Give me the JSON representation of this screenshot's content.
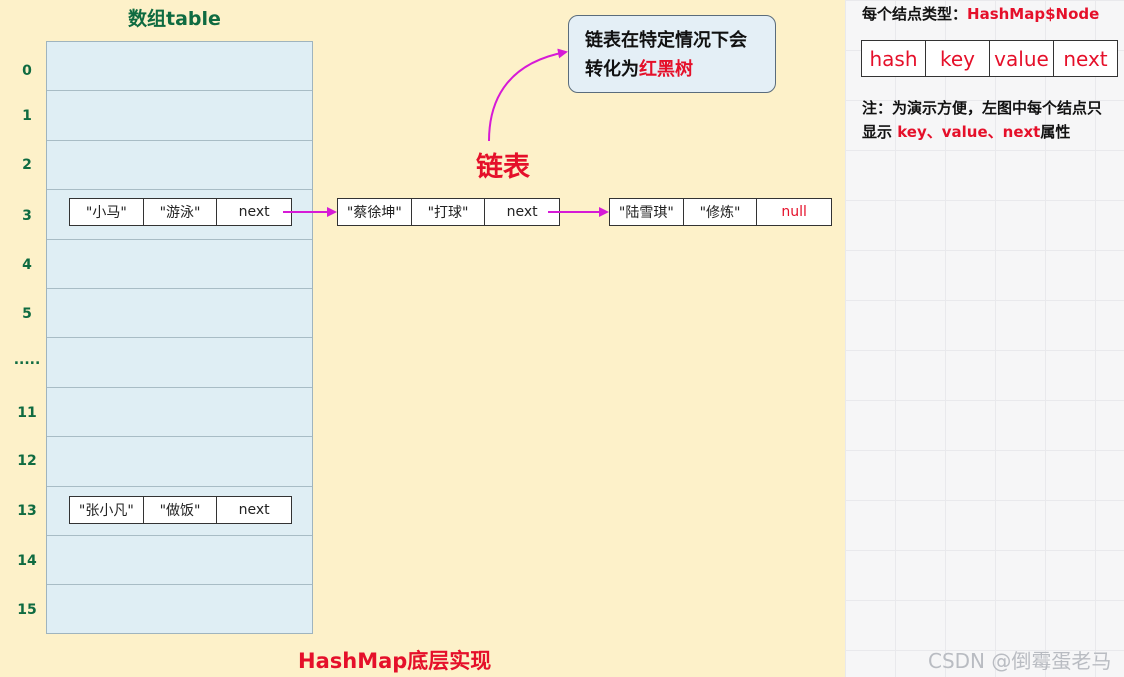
{
  "array": {
    "title": "数组table",
    "indices": [
      "0",
      "1",
      "2",
      "3",
      "4",
      "5",
      ".....",
      "11",
      "12",
      "15"
    ],
    "index_labels": {
      "r0": "0",
      "r1": "1",
      "r2": "2",
      "r3": "3",
      "r4": "4",
      "r5": "5",
      "r6": ".....",
      "r7": "11",
      "r8": "12",
      "r9": "13",
      "r10": "14",
      "r11": "15"
    }
  },
  "nodes": {
    "n1": [
      "\"小马\"",
      "\"游泳\"",
      "next"
    ],
    "n2": [
      "\"蔡徐坤\"",
      "\"打球\"",
      "next"
    ],
    "n3": [
      "\"陆雪琪\"",
      "\"修炼\"",
      "null"
    ],
    "n4": [
      "\"张小凡\"",
      "\"做饭\"",
      "next"
    ]
  },
  "labels": {
    "linked_list": "链表",
    "bubble_line1": "链表在特定情况下会",
    "bubble_line2_prefix": "转化为",
    "bubble_line2_red": "红黑树",
    "footer_title": "HashMap底层实现"
  },
  "right": {
    "node_type_prefix": "每个结点类型：",
    "node_type_name": "HashMap$Node",
    "fields": [
      "hash",
      "key",
      "value",
      "next"
    ],
    "note_line1": "注：为演示方便，左图中每个结点只",
    "note_line2_prefix": "显示 ",
    "note_line2_red": "key、value、next",
    "note_line2_suffix": "属性"
  },
  "watermark": "CSDN @倒霉蛋老马",
  "colors": {
    "panel_bg": "#fdf1c9",
    "table_bg": "#dfeef4",
    "accent_red": "#e5102a",
    "arrow_magenta": "#d61ad6",
    "title_green": "#0f6b41"
  }
}
